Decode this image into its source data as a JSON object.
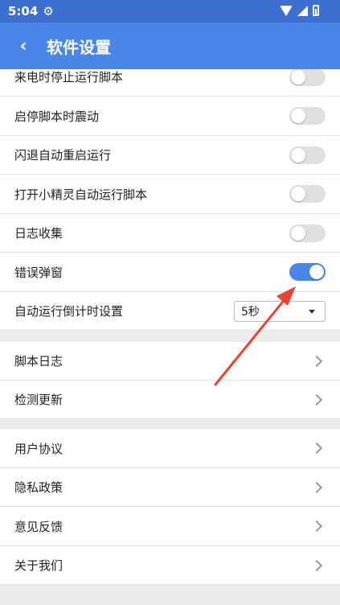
{
  "status_bar": {
    "time": "5:04",
    "icons": [
      "gear-icon",
      "wifi-icon",
      "signal-icon",
      "battery-icon"
    ]
  },
  "app_bar": {
    "title": "软件设置",
    "back_icon": "chevron-left-icon",
    "color": "#4a86e8"
  },
  "settings": {
    "toggles": [
      {
        "label": "来电时停止运行脚本",
        "on": false
      },
      {
        "label": "启停脚本时震动",
        "on": false
      },
      {
        "label": "闪退自动重启运行",
        "on": false
      },
      {
        "label": "打开小精灵自动运行脚本",
        "on": false
      },
      {
        "label": "日志收集",
        "on": false
      },
      {
        "label": "错误弹窗",
        "on": true
      }
    ],
    "countdown": {
      "label": "自动运行倒计时设置",
      "value": "5秒"
    }
  },
  "group_a": [
    {
      "label": "脚本日志"
    },
    {
      "label": "检测更新"
    }
  ],
  "group_b": [
    {
      "label": "用户协议"
    },
    {
      "label": "隐私政策"
    },
    {
      "label": "意见反馈"
    },
    {
      "label": "关于我们"
    }
  ],
  "annotation": {
    "color": "#e8442f"
  }
}
